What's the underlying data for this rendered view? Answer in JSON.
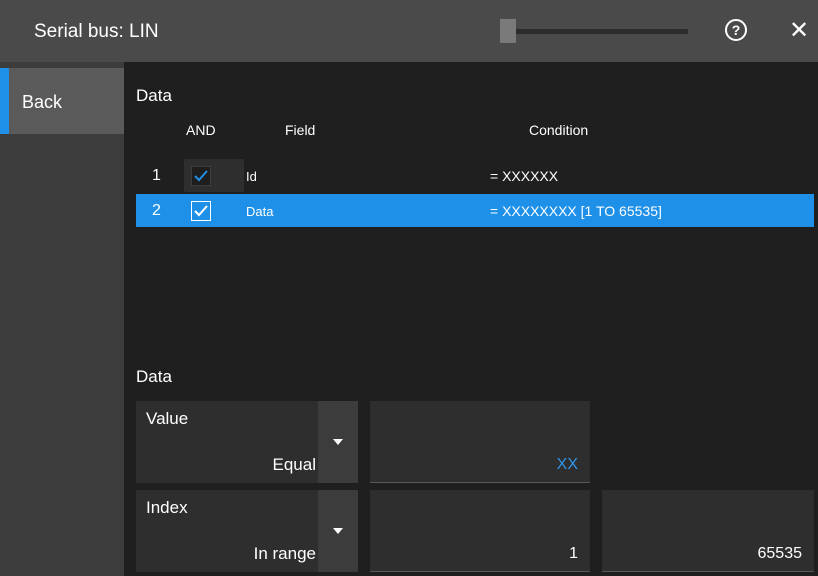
{
  "window": {
    "title": "Serial bus: LIN",
    "help_glyph": "?",
    "close_glyph": "✕"
  },
  "sidebar": {
    "back_label": "Back"
  },
  "data_list": {
    "section_title": "Data",
    "columns": {
      "and": "AND",
      "field": "Field",
      "condition": "Condition"
    },
    "rows": [
      {
        "num": "1",
        "checked": true,
        "field": "Id",
        "condition": "= XXXXXX",
        "selected": false
      },
      {
        "num": "2",
        "checked": true,
        "field": "Data",
        "condition": "= XXXXXXXX [1 TO 65535]",
        "selected": true
      }
    ]
  },
  "data_settings": {
    "section_title": "Data",
    "value": {
      "label": "Value",
      "operator": "Equal",
      "input": "XX"
    },
    "index": {
      "label": "Index",
      "operator": "In range",
      "from": "1",
      "to": "65535"
    }
  },
  "colors": {
    "accent": "#1e90e8",
    "background": "#1f1f1f",
    "titlebar": "#4a4a4a",
    "sidebar": "#3c3c3c"
  },
  "icons": {
    "help": "help-icon",
    "close": "close-icon",
    "checkbox": "check-icon",
    "dropdown": "caret-down-icon"
  }
}
